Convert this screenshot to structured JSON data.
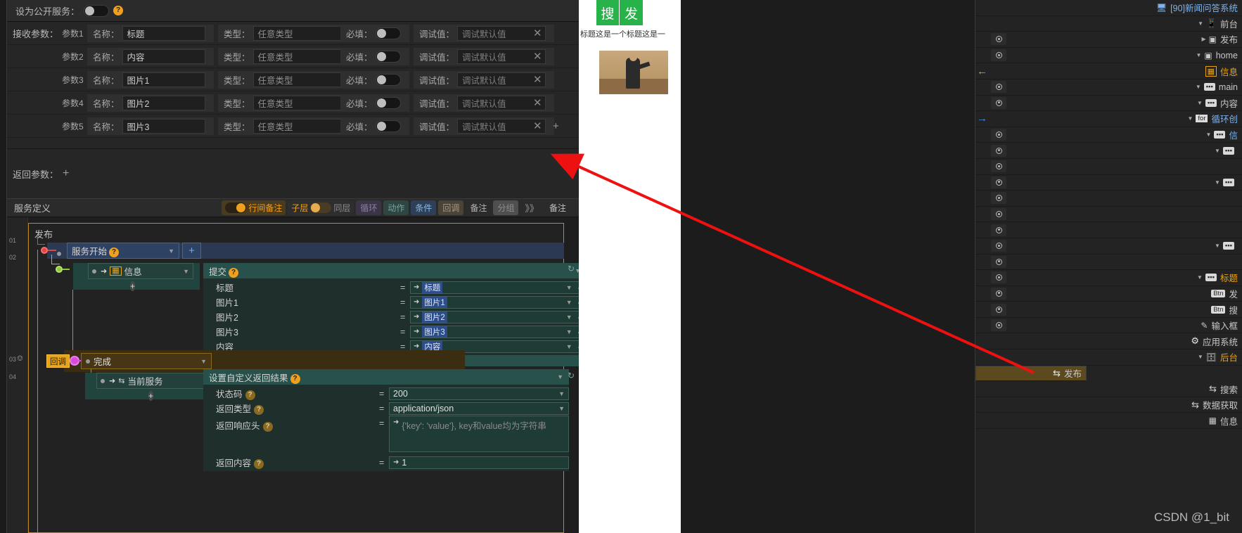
{
  "editor": {
    "public_service": {
      "label": "设为公开服务：",
      "help": "?"
    },
    "receive_params_label": "接收参数：",
    "param_rows": [
      {
        "index": "参数1",
        "name_label": "名称：",
        "name_value": "标题",
        "type_label": "类型：",
        "type_value": "任意类型",
        "required_label": "必填：",
        "debug_label": "调试值：",
        "debug_placeholder": "调试默认值",
        "remove": "✕"
      },
      {
        "index": "参数2",
        "name_label": "名称：",
        "name_value": "内容",
        "type_label": "类型：",
        "type_value": "任意类型",
        "required_label": "必填：",
        "debug_label": "调试值：",
        "debug_placeholder": "调试默认值",
        "remove": "✕"
      },
      {
        "index": "参数3",
        "name_label": "名称：",
        "name_value": "图片1",
        "type_label": "类型：",
        "type_value": "任意类型",
        "required_label": "必填：",
        "debug_label": "调试值：",
        "debug_placeholder": "调试默认值",
        "remove": "✕"
      },
      {
        "index": "参数4",
        "name_label": "名称：",
        "name_value": "图片2",
        "type_label": "类型：",
        "type_value": "任意类型",
        "required_label": "必填：",
        "debug_label": "调试值：",
        "debug_placeholder": "调试默认值",
        "remove": "✕"
      },
      {
        "index": "参数5",
        "name_label": "名称：",
        "name_value": "图片3",
        "type_label": "类型：",
        "type_value": "任意类型",
        "required_label": "必填：",
        "debug_label": "调试值：",
        "debug_placeholder": "调试默认值",
        "remove": "✕",
        "add": "+"
      }
    ],
    "return_params": {
      "label": "返回参数：",
      "add": "+"
    },
    "service_def": {
      "title": "服务定义",
      "toggle_interline": "行间备注",
      "toggle_sublayer": "子层",
      "toggle_samelayer": "同层",
      "chips": [
        "循环",
        "动作",
        "条件",
        "回调",
        "备注",
        "分组"
      ],
      "chip_add": "分组+",
      "note_label": "备注",
      "note_icon": "》》"
    }
  },
  "flow": {
    "title": "发布",
    "gutter": [
      "01",
      "02",
      "03",
      "04"
    ],
    "nodes": {
      "start": {
        "label": "服务开始",
        "help": "?",
        "add": "+"
      },
      "info": {
        "label": "信息",
        "add": "+"
      },
      "submit": {
        "label": "提交",
        "help": "?"
      },
      "done": {
        "label": "完成",
        "badge": "回调"
      },
      "current_service": {
        "label": "当前服务",
        "add": "+"
      },
      "custom_result": {
        "label": "设置自定义返回结果",
        "help": "?"
      }
    },
    "submit_mappings": [
      {
        "key": "标题",
        "eq": "=",
        "value": "标题"
      },
      {
        "key": "图片1",
        "eq": "=",
        "value": "图片1"
      },
      {
        "key": "图片2",
        "eq": "=",
        "value": "图片2"
      },
      {
        "key": "图片3",
        "eq": "=",
        "value": "图片3"
      },
      {
        "key": "内容",
        "eq": "=",
        "value": "内容"
      }
    ],
    "result_rows": [
      {
        "key": "状态码",
        "help": "?",
        "eq": "=",
        "value": "200"
      },
      {
        "key": "返回类型",
        "help": "?",
        "eq": "=",
        "value": "application/json"
      },
      {
        "key": "返回响应头",
        "help": "?",
        "eq": "=",
        "value": "{'key': 'value'}, key和value均为字符串"
      },
      {
        "key": "返回内容",
        "help": "?",
        "eq": "=",
        "value": "1"
      }
    ]
  },
  "preview": {
    "btn_search": "搜",
    "btn_publish": "发",
    "article_title": "标题这是一个标题这是一"
  },
  "tree": {
    "rows": [
      {
        "indent": 0,
        "label": "[90]新闻问答系统",
        "icon": "app-icon",
        "color": "c-gray",
        "eye": false,
        "caret": ""
      },
      {
        "indent": 1,
        "label": "前台",
        "icon": "phone-icon",
        "color": "c-gray",
        "eye": false,
        "caret": "▼"
      },
      {
        "indent": 2,
        "label": "发布",
        "icon": "page-icon",
        "color": "c-gray",
        "eye": true,
        "caret": "▶"
      },
      {
        "indent": 2,
        "label": "home",
        "icon": "page-icon",
        "color": "c-gray",
        "eye": true,
        "caret": "▼"
      },
      {
        "indent": 3,
        "label": "信息",
        "icon": "data-icon",
        "color": "c-orange",
        "eye": false,
        "caret": "",
        "left_arrow": "←"
      },
      {
        "indent": 3,
        "label": "main",
        "icon": "box-icon",
        "color": "c-gray",
        "eye": true,
        "caret": "▼"
      },
      {
        "indent": 4,
        "label": "内容",
        "icon": "box-icon",
        "color": "c-gray",
        "eye": true,
        "caret": "▼"
      },
      {
        "indent": 4,
        "label": "循环创",
        "icon": "for-icon",
        "color": "c-blue",
        "eye": false,
        "caret": "▼",
        "right_arrow": "→"
      },
      {
        "indent": 5,
        "label": "信",
        "icon": "box-icon",
        "color": "c-blue",
        "eye": true,
        "caret": "▼"
      },
      {
        "indent": 6,
        "label": "",
        "icon": "box-icon",
        "color": "c-gray",
        "eye": true,
        "caret": "▼"
      },
      {
        "indent": 6,
        "label": "",
        "icon": "",
        "color": "c-gray",
        "eye": true,
        "caret": ""
      },
      {
        "indent": 6,
        "label": "",
        "icon": "box-icon",
        "color": "c-gray",
        "eye": true,
        "caret": "▼"
      },
      {
        "indent": 6,
        "label": "",
        "icon": "",
        "color": "c-gray",
        "eye": true,
        "caret": ""
      },
      {
        "indent": 6,
        "label": "",
        "icon": "",
        "color": "c-gray",
        "eye": true,
        "caret": ""
      },
      {
        "indent": 6,
        "label": "",
        "icon": "",
        "color": "c-gray",
        "eye": true,
        "caret": ""
      },
      {
        "indent": 6,
        "label": "",
        "icon": "box-icon",
        "color": "c-gray",
        "eye": true,
        "caret": "▼"
      },
      {
        "indent": 6,
        "label": "",
        "icon": "",
        "color": "c-gray",
        "eye": true,
        "caret": ""
      },
      {
        "indent": 5,
        "label": "标题",
        "icon": "box-icon",
        "color": "c-orange",
        "eye": true,
        "caret": "▼"
      },
      {
        "indent": 6,
        "label": "发",
        "icon": "btn-icon",
        "color": "c-gray",
        "eye": true,
        "caret": ""
      },
      {
        "indent": 6,
        "label": "搜",
        "icon": "btn-icon",
        "color": "c-gray",
        "eye": true,
        "caret": ""
      },
      {
        "indent": 6,
        "label": "输入框",
        "icon": "input-icon",
        "color": "c-gray",
        "eye": true,
        "caret": ""
      },
      {
        "indent": 3,
        "label": "应用系统",
        "icon": "gear-icon",
        "color": "c-gray",
        "eye": false,
        "caret": ""
      },
      {
        "indent": 2,
        "label": "后台",
        "icon": "server-icon",
        "color": "c-orange",
        "eye": false,
        "caret": "▼"
      },
      {
        "indent": 3,
        "label": "发布",
        "icon": "service-icon",
        "color": "c-gray",
        "eye": false,
        "caret": "",
        "selected": true
      },
      {
        "indent": 3,
        "label": "搜索",
        "icon": "service-icon",
        "color": "c-gray",
        "eye": false,
        "caret": ""
      },
      {
        "indent": 3,
        "label": "数据获取",
        "icon": "service-icon",
        "color": "c-gray",
        "eye": false,
        "caret": ""
      },
      {
        "indent": 3,
        "label": "信息",
        "icon": "db-icon",
        "color": "c-gray",
        "eye": false,
        "caret": ""
      }
    ]
  },
  "watermark": "CSDN @1_bit",
  "colors": {
    "accent_orange": "#e8a317",
    "select_blue": "#2e4263",
    "teal": "#24403b",
    "brown": "#473515",
    "arrow_red": "#ee1111"
  }
}
